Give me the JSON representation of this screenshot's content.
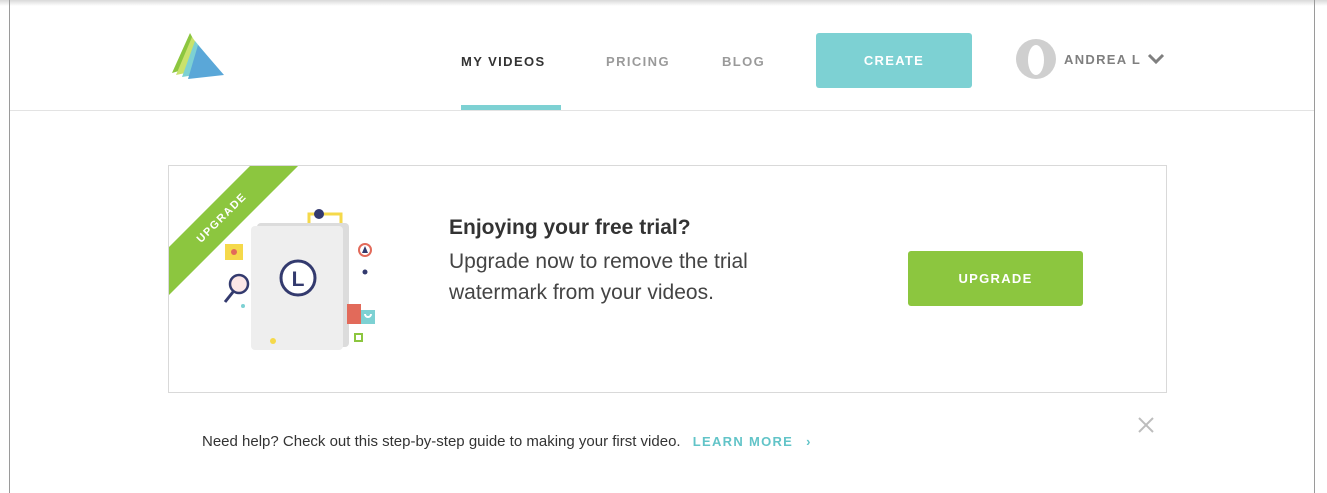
{
  "header": {
    "nav": [
      {
        "label": "MY VIDEOS",
        "active": true
      },
      {
        "label": "PRICING",
        "active": false
      },
      {
        "label": "BLOG",
        "active": false
      }
    ],
    "create_label": "CREATE",
    "user_name": "ANDREA L",
    "logo_icon": "layers-logo-icon",
    "menu_icon": "chevron-down-icon"
  },
  "promo": {
    "ribbon_label": "UPGRADE",
    "title": "Enjoying your free trial?",
    "body": "Upgrade now to remove the trial watermark from your videos.",
    "button_label": "UPGRADE",
    "illustration_letter": "L"
  },
  "help": {
    "text": "Need help? Check out this step-by-step guide to making your first video.",
    "link_label": "LEARN MORE",
    "link_arrow": "›",
    "close_icon": "close-icon"
  },
  "colors": {
    "accent_teal": "#7dd1d3",
    "accent_green": "#8cc63f",
    "link_teal": "#62c4c8"
  }
}
